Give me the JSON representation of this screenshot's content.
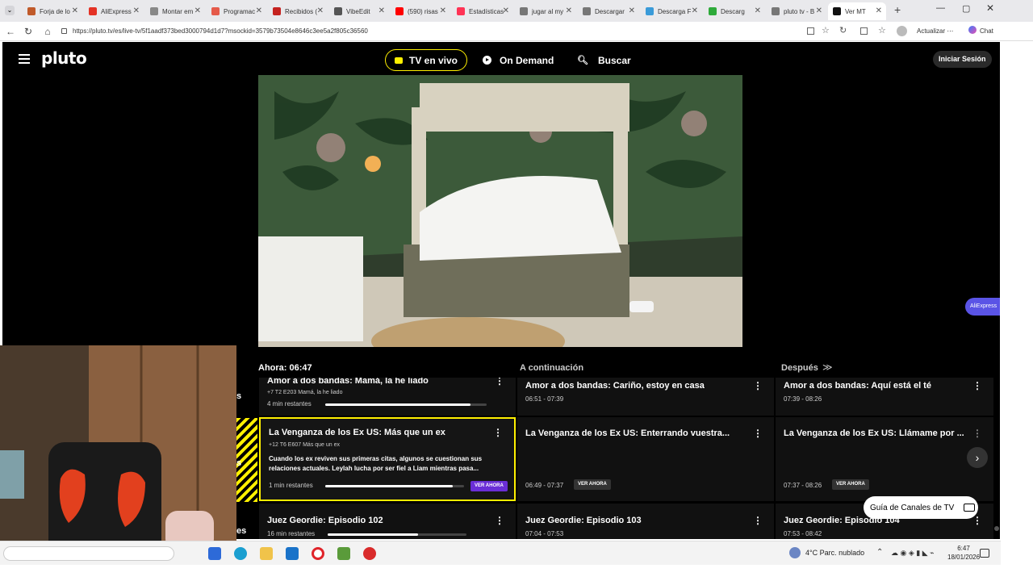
{
  "browser": {
    "tabs": [
      {
        "label": "Forja de lo",
        "color": "#c05a2a"
      },
      {
        "label": "AliExpress",
        "color": "#e43225"
      },
      {
        "label": "Montar em",
        "color": "#888888"
      },
      {
        "label": "Programac",
        "color": "#e55a4a"
      },
      {
        "label": "Recibidos (",
        "color": "#c5221f"
      },
      {
        "label": "VibeEdit",
        "color": "#555555"
      },
      {
        "label": "(590) risas",
        "color": "#ff0000"
      },
      {
        "label": "Estadísticas",
        "color": "#ff3355"
      },
      {
        "label": "jugar al my",
        "color": "#777777"
      },
      {
        "label": "Descargar",
        "color": "#777777"
      },
      {
        "label": "Descarga F",
        "color": "#3a9bd9"
      },
      {
        "label": "Descarg",
        "color": "#2eaa3a"
      },
      {
        "label": "pluto tv - B",
        "color": "#777777"
      },
      {
        "label": "Ver MT",
        "color": "#111111"
      }
    ],
    "new_tab": "+",
    "url": "https://pluto.tv/es/live-tv/5f1aadf373bed3000794d1d7?msockid=3579b73504e8646c3ee5a2f805c36560",
    "update_label": "Actualizar",
    "chat_label": "Chat",
    "back": "←",
    "reload": "↻",
    "home": "⌂"
  },
  "header": {
    "logo": "pluto",
    "nav_live": "TV en vivo",
    "nav_ondemand": "On Demand",
    "nav_search": "Buscar",
    "login": "Iniciar Sesión"
  },
  "aliexpress_tag": "AliExpress",
  "guide": {
    "now": "Ahora: 06:47",
    "next": "A continuación",
    "after": "Después",
    "after_arrow": "≫",
    "kebab": "⋮",
    "row1": {
      "now_title": "Amor a dos bandas: Mamá, la he liado",
      "now_meta": "+7   T2   E203   Mamá, la he liado",
      "now_remaining": "4 min restantes",
      "now_progress": 0.9,
      "next_title": "Amor a dos bandas: Cariño, estoy en casa",
      "next_time": "06:51 - 07:39",
      "after_title": "Amor a dos bandas: Aquí está el té",
      "after_time": "07:39 - 08:26"
    },
    "row2": {
      "now_title": "La Venganza de los Ex US: Más que un ex",
      "now_meta": "+12   T6   E607   Más que un ex",
      "now_desc": "Cuando los ex reviven sus primeras citas, algunos se cuestionan sus relaciones actuales. Leylah lucha por ser fiel a Liam mientras pasa...",
      "now_remaining": "1 min restantes",
      "now_progress": 0.92,
      "now_button": "VER AHORA",
      "next_title": "La Venganza de los Ex US: Enterrando vuestra...",
      "next_time": "06:49 - 07:37",
      "next_button": "VER AHORA",
      "after_title": "La Venganza de los Ex US: Llámame por ...",
      "after_time": "07:37 - 08:26",
      "after_button": "VER AHORA"
    },
    "row3": {
      "now_title": "Juez Geordie: Episodio 102",
      "now_remaining": "16 min restantes",
      "now_progress": 0.65,
      "next_title": "Juez Geordie: Episodio 103",
      "next_time": "07:04 - 07:53",
      "after_title": "Juez Geordie: Episodio 104",
      "after_time": "07:53 - 08:42"
    },
    "channel_cutoff": [
      "s",
      "s",
      "es"
    ]
  },
  "guide_button": "Guía de Canales de TV",
  "next_arrow": "›",
  "taskbar": {
    "weather": "4°C  Parc. nublado",
    "time": "6:47",
    "date": "18/01/2026"
  }
}
